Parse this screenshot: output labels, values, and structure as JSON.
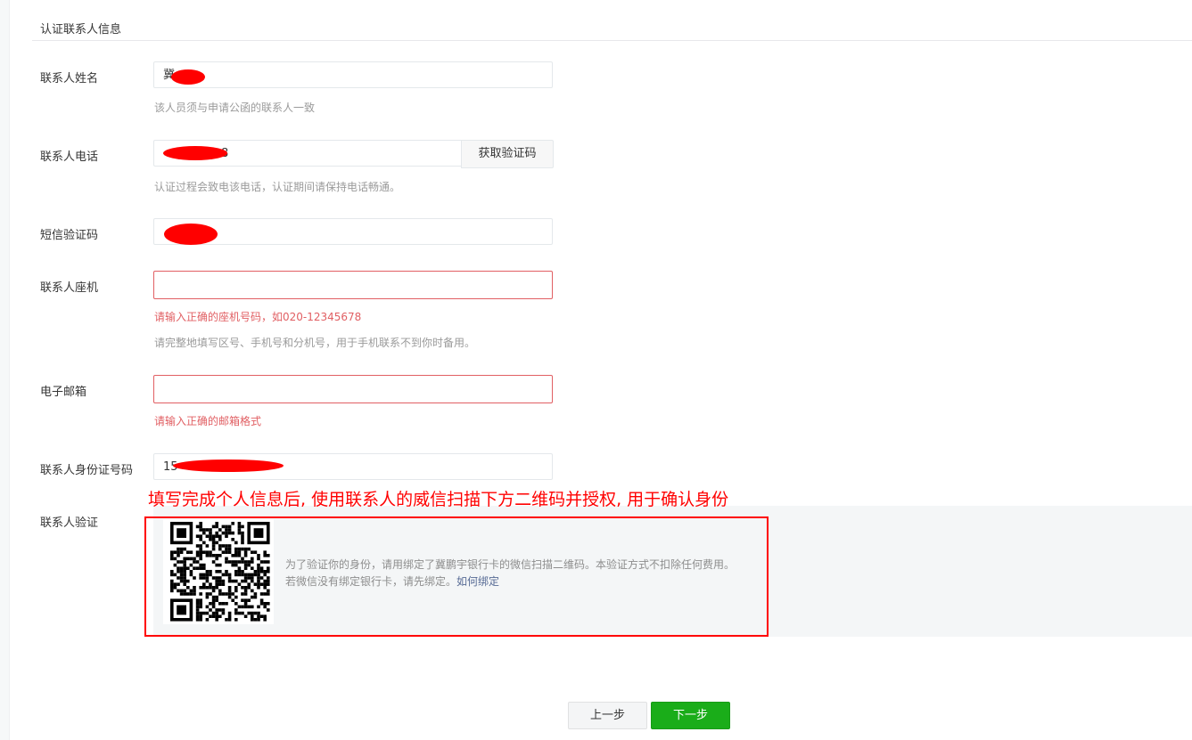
{
  "section": {
    "title": "认证联系人信息"
  },
  "fields": {
    "name": {
      "label": "联系人姓名",
      "value": "冀",
      "tip": "该人员须与申请公函的联系人一致"
    },
    "phone": {
      "label": "联系人电话",
      "value": "8",
      "tip": "认证过程会致电该电话，认证期间请保持电话畅通。",
      "get_code_label": "获取验证码"
    },
    "sms": {
      "label": "短信验证码",
      "value": ""
    },
    "landline": {
      "label": "联系人座机",
      "value": "",
      "error": "请输入正确的座机号码，如020-12345678",
      "tip": "请完整地填写区号、手机号和分机号，用于手机联系不到你时备用。"
    },
    "email": {
      "label": "电子邮箱",
      "value": "",
      "error": "请输入正确的邮箱格式"
    },
    "idcard": {
      "label": "联系人身份证号码",
      "value": "15"
    }
  },
  "verify": {
    "label": "联系人验证",
    "annotation": "填写完成个人信息后, 使用联系人的威信扫描下方二维码并授权, 用于确认身份",
    "line1": "为了验证你的身份，请用绑定了冀鹏宇银行卡的微信扫描二维码。本验证方式不扣除任何费用。",
    "line2": "若微信没有绑定银行卡，请先绑定。",
    "link": "如何绑定"
  },
  "buttons": {
    "prev": "上一步",
    "next": "下一步"
  },
  "colors": {
    "accent": "#1aad19",
    "error": "#e15f63",
    "annotation": "#ff0000",
    "link": "#576b95"
  }
}
